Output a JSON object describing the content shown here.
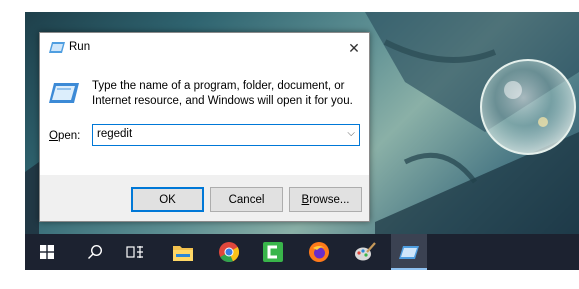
{
  "dialog": {
    "title": "Run",
    "close_label": "✕",
    "description": "Type the name of a program, folder, document, or Internet resource, and Windows will open it for you.",
    "open_label_underlined": "O",
    "open_label_rest": "pen:",
    "input_value": "regedit",
    "dropdown_glyph": "⌵",
    "buttons": {
      "ok": "OK",
      "cancel": "Cancel",
      "browse_underlined": "B",
      "browse_rest": "rowse..."
    }
  },
  "taskbar": {
    "icons": [
      "windows-start-icon",
      "search-icon",
      "task-view-icon",
      "file-explorer-icon",
      "chrome-icon",
      "camtasia-icon",
      "firefox-icon",
      "paint-icon",
      "run-icon"
    ]
  },
  "colors": {
    "accent": "#0078d7",
    "taskbar": "#1c2230",
    "dialog_bg": "#f0f0f0"
  }
}
